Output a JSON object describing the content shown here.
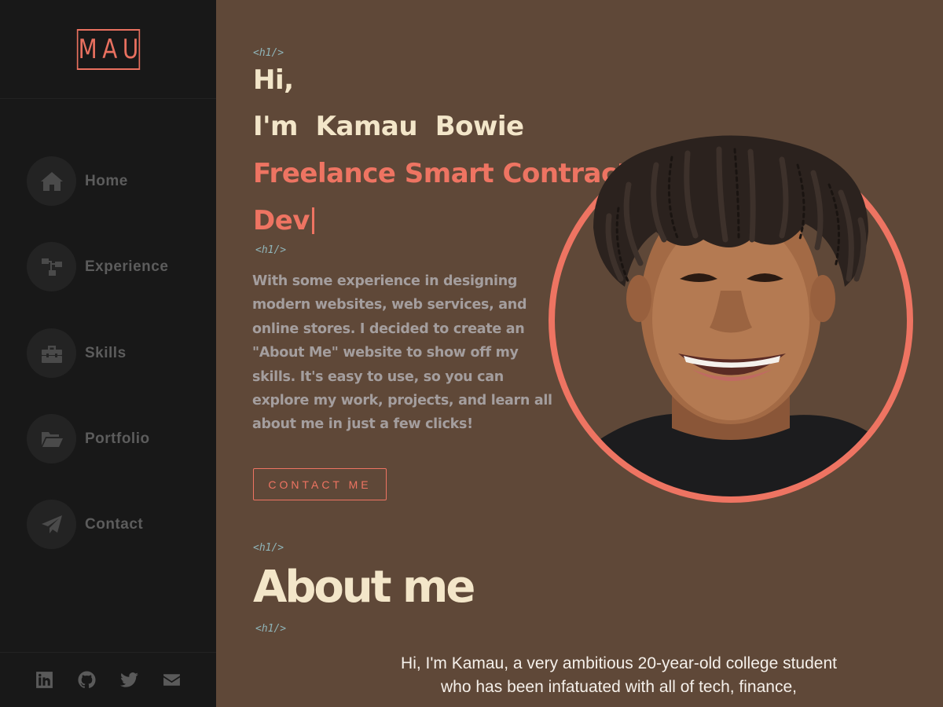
{
  "sidebar": {
    "logo": "MAU",
    "nav": [
      {
        "label": "Home",
        "icon": "home-icon"
      },
      {
        "label": "Experience",
        "icon": "sitemap-icon"
      },
      {
        "label": "Skills",
        "icon": "toolbox-icon"
      },
      {
        "label": "Portfolio",
        "icon": "folder-open-icon"
      },
      {
        "label": "Contact",
        "icon": "paper-plane-icon"
      }
    ],
    "social": [
      "linkedin-icon",
      "github-icon",
      "twitter-icon",
      "envelope-icon"
    ]
  },
  "hero": {
    "tag_open": "<h1/>",
    "greeting": "Hi,",
    "name_line": "I'm  Kamau  Bowie",
    "role_line1": "Freelance Smart Contract",
    "role_line2": "Dev",
    "tag_close": "<h1/>",
    "intro": "With some experience in designing modern websites, web services, and online stores. I decided to create an \"About Me\" website to show off my skills. It's easy to use, so you can explore my work, projects, and learn all about me in just a few clicks!",
    "contact_button": "CONTACT ME"
  },
  "about": {
    "tag_open": "<h1/>",
    "title": "About me",
    "tag_close": "<h1/>",
    "text": "Hi, I'm Kamau, a very ambitious 20-year-old college student who has been infatuated with all of tech, finance,"
  },
  "colors": {
    "sidebar_bg": "#181818",
    "main_bg": "#5f4838",
    "accent": "#ee7462",
    "heading": "#f3e6c9",
    "muted": "#a49e9e",
    "code_tag": "#8fb4b8"
  }
}
